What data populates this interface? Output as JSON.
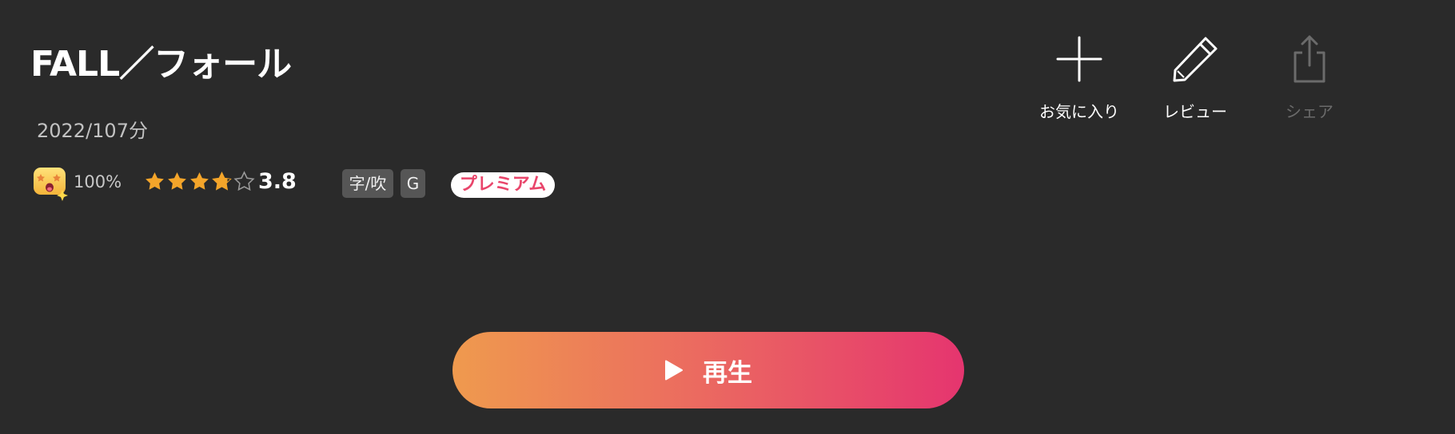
{
  "header": {
    "title": "FALL／フォール",
    "meta": "2022/107分"
  },
  "stats": {
    "favorite_percent": "100%",
    "rating_value": "3.8",
    "rating": 3.8,
    "rating_max": 5,
    "tags": {
      "subtitle_dub": "字/吹",
      "age_rating": "G"
    },
    "premium_label": "プレミアム"
  },
  "actions": {
    "favorite_label": "お気に入り",
    "review_label": "レビュー",
    "share_label": "シェア"
  },
  "play": {
    "label": "再生"
  },
  "colors": {
    "background": "#2a2a2a",
    "premium_text": "#e9456b",
    "play_gradient_start": "#ef9a4e",
    "play_gradient_end": "#e5356f",
    "star_fill": "#f4a52a",
    "disabled": "#6b6b6b"
  },
  "icons": {
    "favorite": "plus-icon",
    "review": "pencil-icon",
    "share": "share-icon",
    "play": "play-icon",
    "emoji": "starstruck-emoji-icon"
  }
}
